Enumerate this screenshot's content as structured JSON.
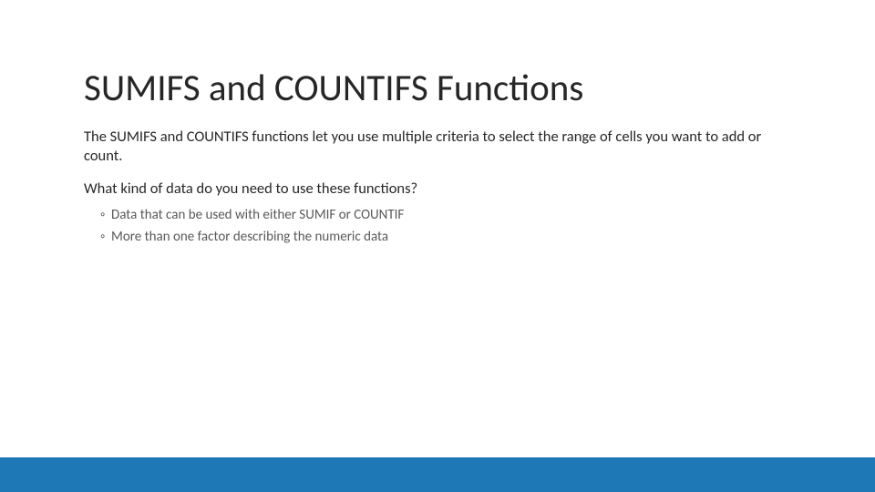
{
  "slide": {
    "title": "SUMIFS and COUNTIFS Functions",
    "intro": "The SUMIFS and COUNTIFS functions let you use multiple criteria to select the range of cells you want to add or count.",
    "question": "What kind of data do you need to use these functions?",
    "bullets": [
      "Data that can be used with either SUMIF or COUNTIF",
      "More than one factor describing the numeric data"
    ]
  }
}
